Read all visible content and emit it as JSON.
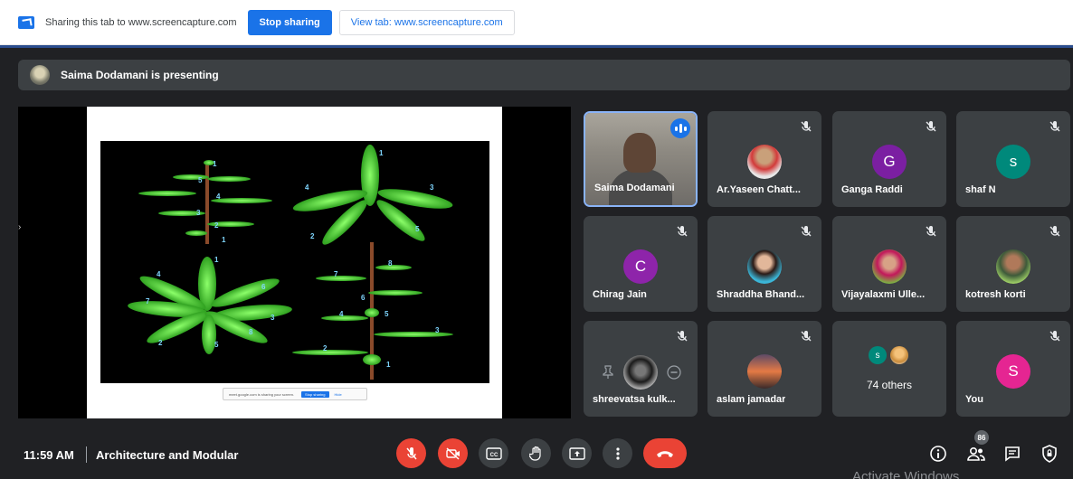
{
  "share_bar": {
    "text": "Sharing this tab to www.screencapture.com",
    "stop_label": "Stop sharing",
    "view_label": "View tab: www.screencapture.com"
  },
  "presenting": {
    "text": "Saima Dodamani is presenting"
  },
  "slide": {
    "labels_a": [
      "1",
      "5",
      "4",
      "3",
      "2",
      "1"
    ],
    "labels_b": [
      "1",
      "4",
      "3",
      "2",
      "5"
    ],
    "labels_c": [
      "1",
      "4",
      "6",
      "7",
      "3",
      "8",
      "2",
      "5"
    ],
    "labels_d": [
      "8",
      "7",
      "6",
      "5",
      "4",
      "3",
      "2",
      "1"
    ],
    "notice": {
      "text": "meet.google.com is sharing your screen.",
      "stop": "Stop sharing",
      "hide": "Hide"
    }
  },
  "participants": [
    {
      "name": "Saima Dodamani",
      "kind": "video",
      "speaking": true
    },
    {
      "name": "Ar.Yaseen Chatt...",
      "kind": "photo",
      "muted": true
    },
    {
      "name": "Ganga Raddi",
      "kind": "letter",
      "letter": "G",
      "color": "#7b1fa2",
      "muted": true
    },
    {
      "name": "shaf N",
      "kind": "letter",
      "letter": "s",
      "color": "#00897b",
      "muted": true
    },
    {
      "name": "Chirag Jain",
      "kind": "letter",
      "letter": "C",
      "color": "#8e24aa",
      "muted": true
    },
    {
      "name": "Shraddha Bhand...",
      "kind": "photo",
      "muted": true
    },
    {
      "name": "Vijayalaxmi Ulle...",
      "kind": "photo",
      "muted": true
    },
    {
      "name": "kotresh korti",
      "kind": "photo",
      "muted": true
    },
    {
      "name": "shreevatsa kulk...",
      "kind": "photo",
      "muted": true
    },
    {
      "name": "aslam jamadar",
      "kind": "photo",
      "muted": true
    },
    {
      "name": "74 others",
      "kind": "others",
      "chip_letter": "s"
    },
    {
      "name": "You",
      "kind": "letter",
      "letter": "S",
      "color": "#e52592",
      "muted": true
    }
  ],
  "bottom": {
    "time": "11:59 AM",
    "title": "Architecture and Modular",
    "people_count": "86"
  },
  "watermark": "Activate Windows"
}
